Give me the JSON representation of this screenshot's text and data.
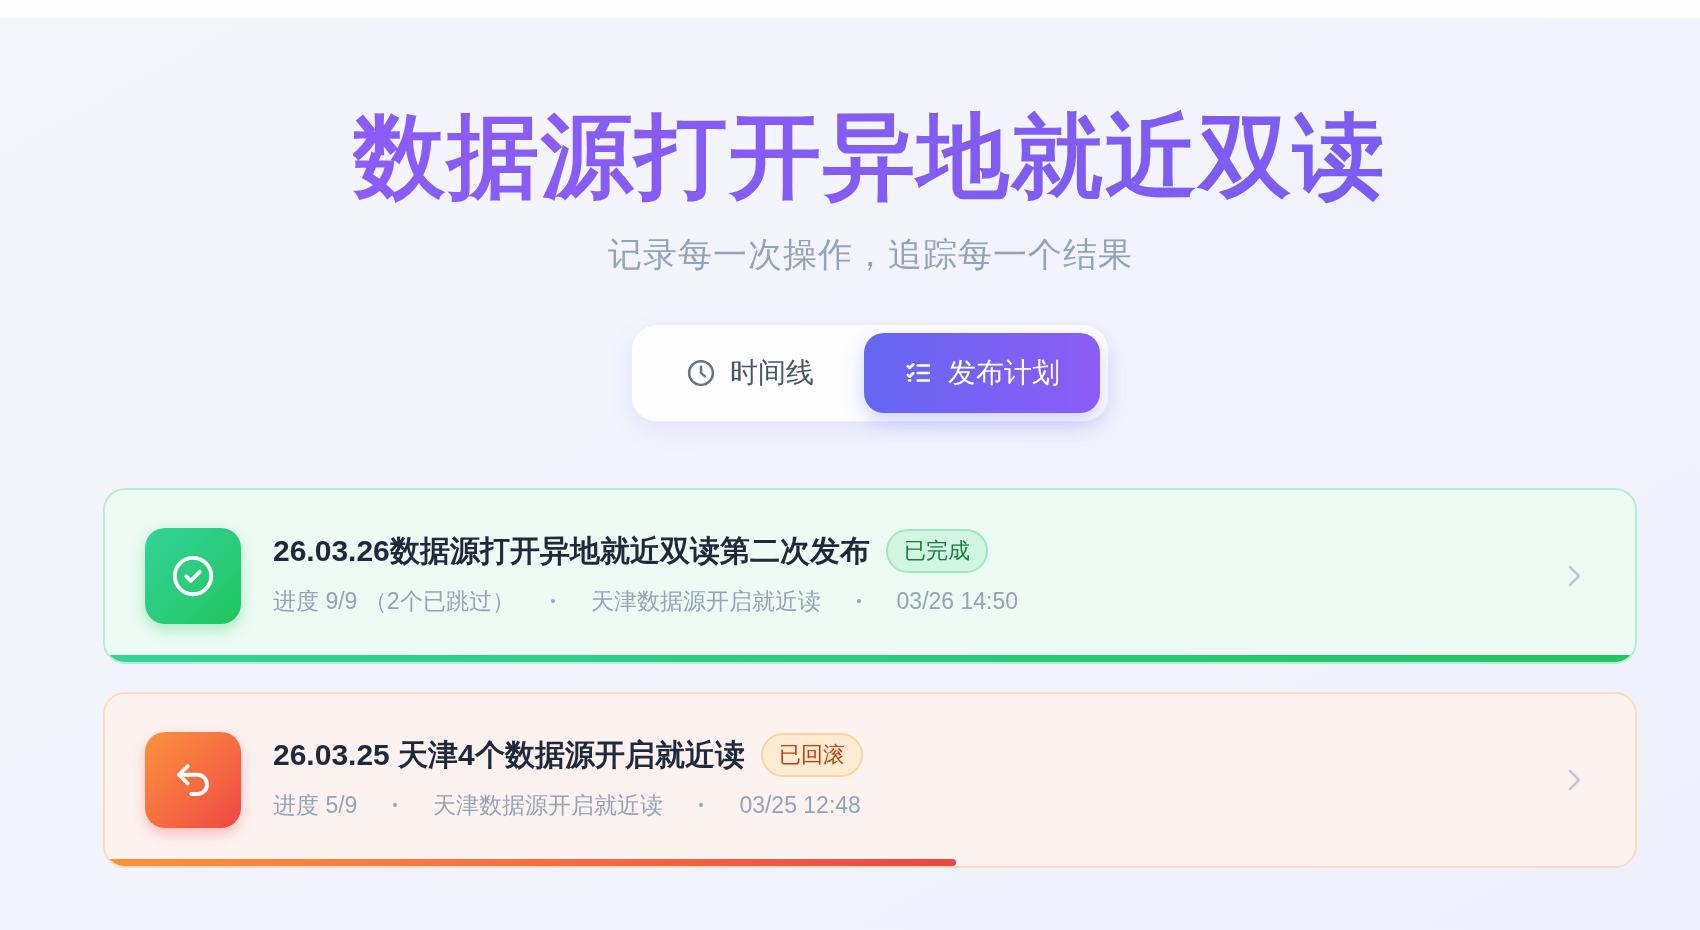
{
  "header": {
    "title": "数据源打开异地就近双读",
    "subtitle": "记录每一次操作，追踪每一个结果"
  },
  "tabs": [
    {
      "label": "时间线",
      "kind": "clock",
      "selected": false
    },
    {
      "label": "发布计划",
      "kind": "checklist",
      "selected": true
    }
  ],
  "plans": [
    {
      "kind": "done",
      "title": "26.03.26数据源打开异地就近双读第二次发布",
      "badge": "已完成",
      "meta": [
        "进度 9/9 （2个已跳过）",
        "天津数据源开启就近读",
        "03/26 14:50"
      ],
      "level": 1.0
    },
    {
      "kind": "rolled_back",
      "title": "26.03.25 天津4个数据源开启就近读",
      "badge": "已回滚",
      "meta": [
        "进度 5/9",
        "天津数据源开启就近读",
        "03/25 12:48"
      ],
      "level": 0.556
    }
  ]
}
